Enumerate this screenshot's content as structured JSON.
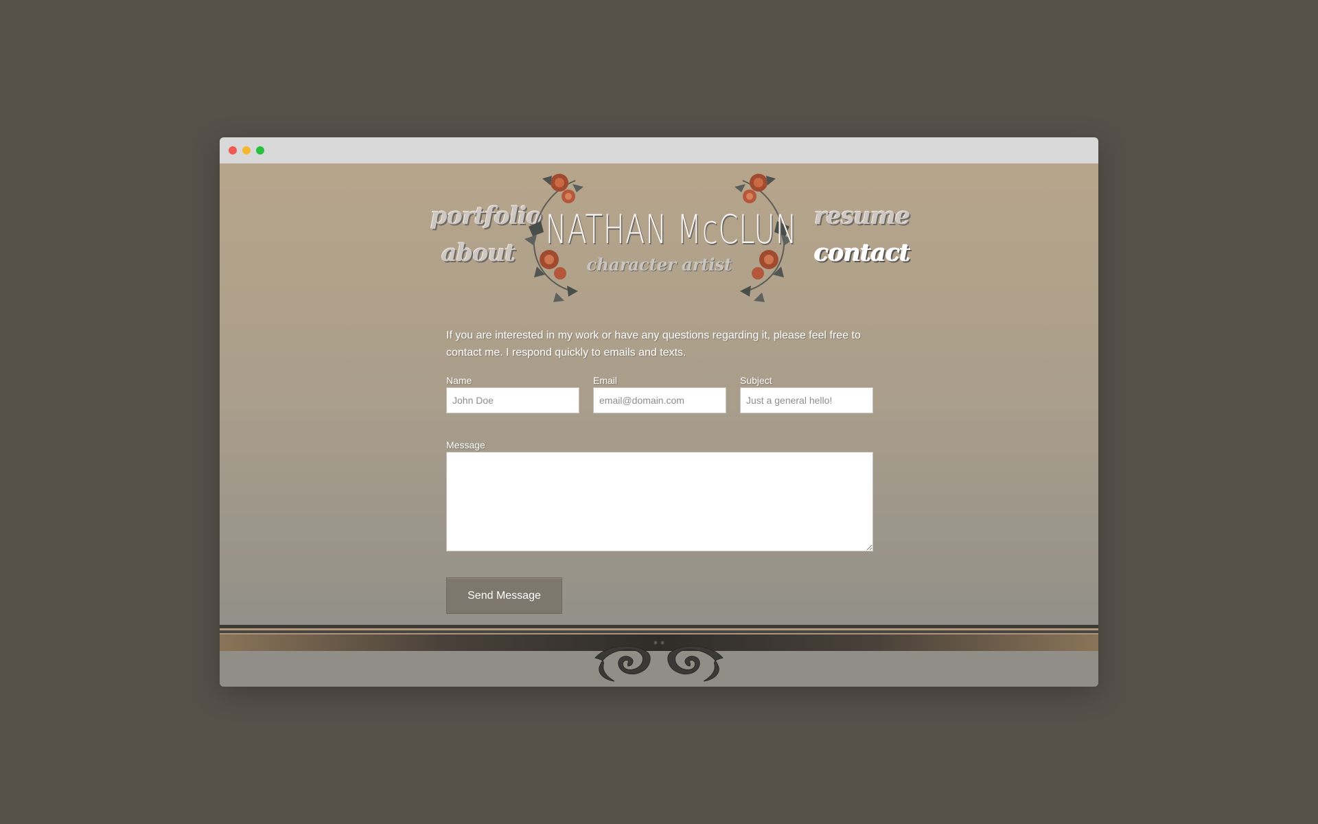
{
  "window": {
    "controls": [
      "close",
      "minimize",
      "maximize"
    ]
  },
  "nav": {
    "portfolio": "portfolio",
    "about": "about",
    "resume": "resume",
    "contact": "contact",
    "active": "contact"
  },
  "brand": {
    "name": "NATHAN McCLUN",
    "subtitle": "character artist",
    "decoration": "roses-wreath"
  },
  "contact": {
    "intro": "If you are interested in my work or have any questions regarding it, please feel free to contact me. I respond quickly to emails and texts.",
    "fields": {
      "name": {
        "label": "Name",
        "placeholder": "John Doe",
        "value": ""
      },
      "email": {
        "label": "Email",
        "placeholder": "email@domain.com",
        "value": ""
      },
      "subject": {
        "label": "Subject",
        "placeholder": "Just a general hello!",
        "value": ""
      },
      "message": {
        "label": "Message",
        "value": ""
      }
    },
    "submit_label": "Send Message"
  },
  "footer": {
    "ornament": "scroll-flourish"
  },
  "colors": {
    "desktop_bg": "#565049",
    "titlebar": "#d9d9d9",
    "page_top": "#b7a58b",
    "page_bottom": "#8e8d86",
    "button": "#7e776d",
    "nav_active": "#ffffff",
    "nav_inactive": "#cfc8c2"
  }
}
